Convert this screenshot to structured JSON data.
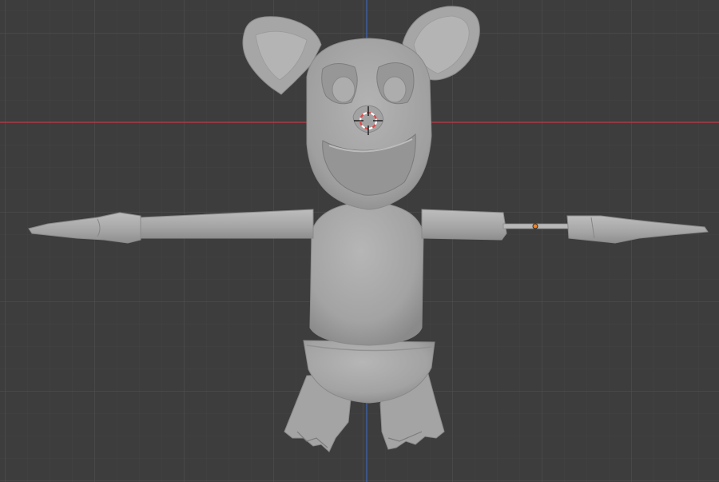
{
  "viewport": {
    "mode": "3d-viewport",
    "view": "front-orthographic",
    "background_color": "#3d3d3d",
    "grid_minor_color": "#444444",
    "grid_major_color": "#4e4e4e",
    "x_axis_color": "#a83a45",
    "z_axis_color": "#3c5f9c"
  },
  "scene": {
    "model": {
      "description_icon": "t-pose-character-mesh",
      "shading": "solid",
      "base_color": "#a9a9a9"
    },
    "cursor": {
      "icon": "3d-cursor-icon",
      "ring_colors": [
        "#e04a4a",
        "#ffffff"
      ]
    },
    "origin_marker": {
      "icon": "object-origin-icon",
      "color": "#f08020"
    }
  }
}
